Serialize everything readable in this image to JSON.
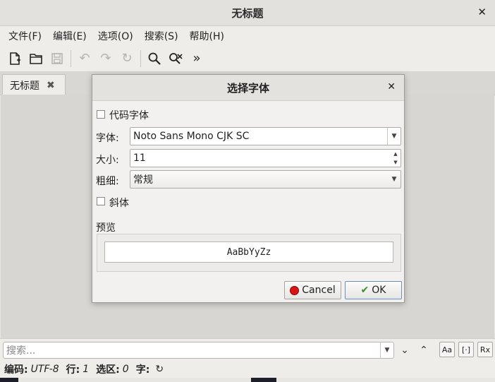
{
  "window": {
    "title": "无标题"
  },
  "menu": [
    "文件(F)",
    "编辑(E)",
    "选项(O)",
    "搜索(S)",
    "帮助(H)"
  ],
  "tab": {
    "label": "无标题"
  },
  "dialog": {
    "title": "选择字体",
    "code_font_label": "代码字体",
    "font_label": "字体:",
    "font_value": "Noto Sans Mono CJK SC",
    "size_label": "大小:",
    "size_value": "11",
    "weight_label": "粗细:",
    "weight_value": "常规",
    "italic_label": "斜体",
    "preview_label": "预览",
    "preview_text": "AaBbYyZz",
    "cancel_label": "Cancel",
    "ok_label": "OK"
  },
  "search": {
    "placeholder": "搜索..."
  },
  "status": {
    "encoding_label": "编码:",
    "encoding_value": "UTF-8",
    "line_label": "行:",
    "line_value": "1",
    "selection_label": "选区:",
    "selection_value": "0",
    "char_label": "字:"
  },
  "icons": {
    "new": "new-file-icon",
    "open": "open-folder-icon",
    "save": "save-icon",
    "undo": "undo-icon",
    "redo": "redo-icon",
    "reload": "reload-icon",
    "find": "search-icon",
    "replace": "replace-icon",
    "more": "more-icon"
  }
}
